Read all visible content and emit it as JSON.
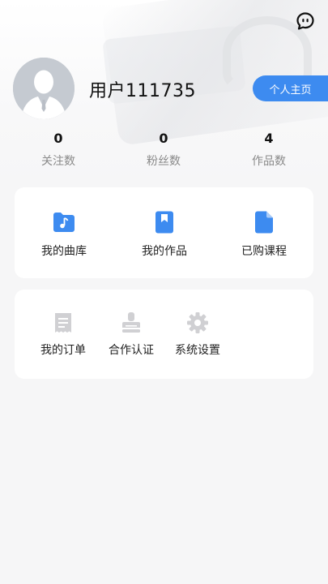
{
  "header": {
    "username": "用户111735",
    "homepage_label": "个人主页",
    "chat_icon": "chat-bubble-icon",
    "avatar_icon": "default-avatar-icon"
  },
  "stats": [
    {
      "value": "0",
      "label": "关注数"
    },
    {
      "value": "0",
      "label": "粉丝数"
    },
    {
      "value": "4",
      "label": "作品数"
    }
  ],
  "main_menu": [
    {
      "label": "我的曲库",
      "icon": "music-folder-icon"
    },
    {
      "label": "我的作品",
      "icon": "bookmark-book-icon"
    },
    {
      "label": "已购课程",
      "icon": "document-icon"
    }
  ],
  "secondary_menu": [
    {
      "label": "我的订单",
      "icon": "receipt-icon"
    },
    {
      "label": "合作认证",
      "icon": "stamp-icon"
    },
    {
      "label": "系统设置",
      "icon": "gear-icon"
    }
  ],
  "colors": {
    "accent": "#3d8bf0",
    "gray_icon": "#c9c9cc",
    "page_bg": "#f6f6f7"
  }
}
